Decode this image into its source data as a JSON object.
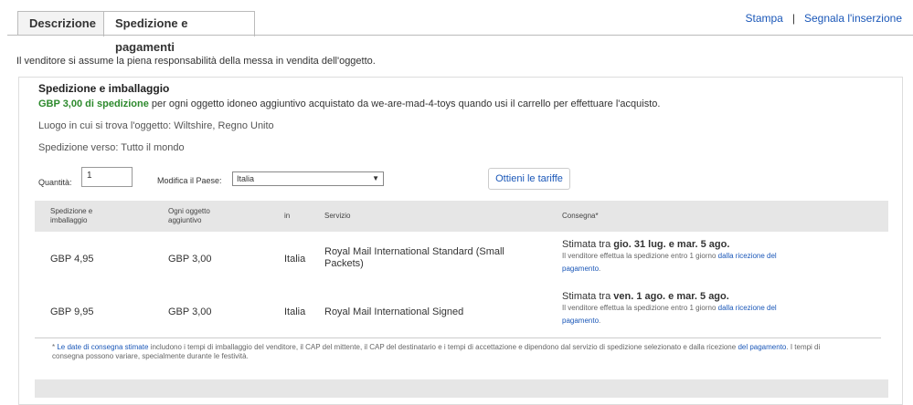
{
  "tabs": [
    {
      "label": "Descrizione",
      "active": false
    },
    {
      "label": "Spedizione e pagamenti",
      "active": true
    }
  ],
  "toplinks": {
    "print": "Stampa",
    "separator": "|",
    "report": "Segnala l'inserzione"
  },
  "responsibility": "Il venditore si assume la piena responsabilità della messa in vendita dell'oggetto.",
  "shipping": {
    "title": "Spedizione e imballaggio",
    "discount_amount": "GBP 3,00 di spedizione",
    "discount_text": "per ogni oggetto idoneo aggiuntivo acquistato da we-are-mad-4-toys quando usi il carrello per effettuare l'acquisto.",
    "location": "Luogo in cui si trova l'oggetto: Wiltshire, Regno Unito",
    "ships_to": "Spedizione verso: Tutto il mondo",
    "quantity_label": "Quantità:",
    "quantity_value": "1",
    "country_label": "Modifica il Paese:",
    "country_value": "Italia",
    "rates_button": "Ottieni le tariffe"
  },
  "table": {
    "headers": {
      "shipping1": "Spedizione e",
      "shipping2": "imballaggio",
      "each1": "Ogni oggetto",
      "each2": "aggiuntivo",
      "to": "in",
      "service": "Servizio",
      "delivery": "Consegna*"
    },
    "rows": [
      {
        "cost": "GBP 4,95",
        "each": "GBP 3,00",
        "to": "Italia",
        "service": "Royal Mail International Standard (Small Packets)",
        "est_prefix": "Stimata tra",
        "est_dates": "gio. 31 lug. e mar. 5 ago.",
        "note_prefix": "Il venditore effettua la spedizione entro 1 giorno",
        "note_link1": "dalla ricezione del",
        "note_link2": "pagamento",
        "note_suffix": "."
      },
      {
        "cost": "GBP 9,95",
        "each": "GBP 3,00",
        "to": "Italia",
        "service": "Royal Mail International Signed",
        "est_prefix": "Stimata tra",
        "est_dates": "ven. 1 ago. e mar. 5 ago.",
        "note_prefix": "Il venditore effettua la spedizione entro 1 giorno",
        "note_link1": "dalla ricezione del",
        "note_link2": "pagamento",
        "note_suffix": "."
      }
    ]
  },
  "footnote": {
    "star": "*",
    "link1": "Le date di consegna stimate",
    "text1": "includono i tempi di imballaggio del venditore, il CAP del mittente, il CAP del destinatario e i tempi di accettazione e dipendono dal servizio di spedizione selezionato e dalla ricezione",
    "link2": "del pagamento",
    "text2": ". I tempi di consegna possono variare, specialmente durante le festività."
  }
}
